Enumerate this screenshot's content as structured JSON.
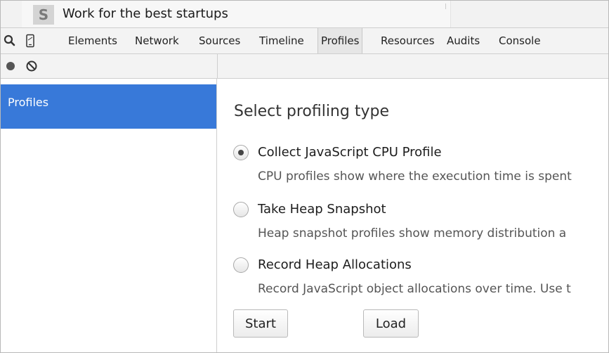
{
  "browser_tab": {
    "favicon_letter": "S",
    "title": "Work for the best startups"
  },
  "devtools": {
    "tabs": [
      {
        "label": "Elements",
        "active": false
      },
      {
        "label": "Network",
        "active": false
      },
      {
        "label": "Sources",
        "active": false
      },
      {
        "label": "Timeline",
        "active": false
      },
      {
        "label": "Profiles",
        "active": true
      },
      {
        "label": "Resources",
        "active": false
      },
      {
        "label": "Audits",
        "active": false
      },
      {
        "label": "Console",
        "active": false
      }
    ],
    "icons": [
      "search-icon",
      "device-icon",
      "record-icon",
      "clear-icon"
    ]
  },
  "sidebar": {
    "items": [
      {
        "label": "Profiles",
        "selected": true
      }
    ]
  },
  "panel": {
    "title": "Select profiling type",
    "options": [
      {
        "label": "Collect JavaScript CPU Profile",
        "description": "CPU profiles show where the execution time is spent",
        "checked": true
      },
      {
        "label": "Take Heap Snapshot",
        "description": "Heap snapshot profiles show memory distribution a",
        "checked": false
      },
      {
        "label": "Record Heap Allocations",
        "description": "Record JavaScript object allocations over time. Use t",
        "checked": false
      }
    ],
    "start_label": "Start",
    "load_label": "Load"
  },
  "colors": {
    "selection": "#3879d9",
    "toolbar_bg": "#f3f3f3"
  }
}
